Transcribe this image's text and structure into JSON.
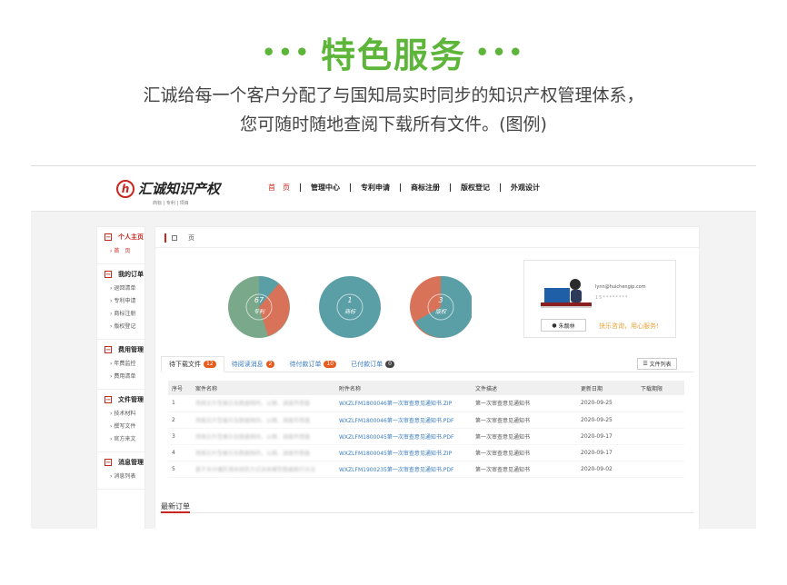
{
  "hero": {
    "dots_left": "•••",
    "title": "特色服务",
    "dots_right": "•••",
    "line1": "汇诚给每一个客户分配了与国知局实时同步的知识产权管理体系，",
    "line2": "您可随时随地查阅下载所有文件。(图例)"
  },
  "header": {
    "logo_text": "汇诚知识产权",
    "logo_tagline": "商标 | 专利 | 项目",
    "nav": [
      "首　页",
      "管理中心",
      "专利申请",
      "商标注册",
      "版权登记",
      "外观设计"
    ]
  },
  "sidebar": {
    "groups": [
      {
        "title": "个人主页",
        "items": [
          "首　页"
        ]
      },
      {
        "title": "我的订单",
        "items": [
          "退回清单",
          "专利申请",
          "商标注册",
          "版权登记"
        ]
      },
      {
        "title": "费用管理",
        "items": [
          "年费监控",
          "费用清单"
        ]
      },
      {
        "title": "文件管理",
        "items": [
          "技术材料",
          "撰写文件",
          "官方来文"
        ]
      },
      {
        "title": "消息管理",
        "items": [
          "消息列表"
        ]
      }
    ]
  },
  "breadcrumb": {
    "label": "页"
  },
  "stats": [
    {
      "count": "67",
      "label": "专利",
      "color": "#7aa88a"
    },
    {
      "count": "1",
      "label": "商标",
      "color": "#5a9fa5"
    },
    {
      "count": "3",
      "label": "版权",
      "color": "#d8735a"
    }
  ],
  "contact": {
    "email": "lynn@huichengip.com",
    "phone": "15********",
    "name": "朱靓林",
    "slogan": "快乐咨询，用心服务!"
  },
  "tabs": [
    {
      "label": "待下载文件",
      "count": "12",
      "badge": "orange"
    },
    {
      "label": "待阅读消息",
      "count": "2",
      "badge": "orange"
    },
    {
      "label": "待付款订单",
      "count": "10",
      "badge": "orange"
    },
    {
      "label": "已付款订单",
      "count": "0",
      "badge": "grey"
    }
  ],
  "file_list_button": "文件列表",
  "table": {
    "headers": [
      "序号",
      "案件名称",
      "附件名称",
      "文件描述",
      "更新日期",
      "下载期限"
    ],
    "rows": [
      [
        "1",
        "用图文片型展示及数据相同，以梯、调度传感器",
        "WXZLFM1800046第一次审查意见通知书.ZIP",
        "第一次审查意见通知书",
        "2020-09-25",
        ""
      ],
      [
        "2",
        "用图文片型展示及数据相同，以梯、调度传感器",
        "WXZLFM1800046第一次审查意见通知书.PDF",
        "第一次审查意见通知书",
        "2020-09-25",
        ""
      ],
      [
        "3",
        "用图文片型展示及数据相同，以梯、调度传感器",
        "WXZLFM1800045第一次审查意见通知书.PDF",
        "第一次审查意见通知书",
        "2020-09-17",
        ""
      ],
      [
        "4",
        "用图文片型展示及数据相同，以梯、调度传感器",
        "WXZLFM1800045第一次审查意见通知书.ZIP",
        "第一次审查意见通知书",
        "2020-09-17",
        ""
      ],
      [
        "5",
        "基于多分播防滑系统防力式自体模型数据图只分法",
        "WXZLFM1900235第一次审查意见通知书.PDF",
        "第一次审查意见通知书",
        "2020-09-02",
        ""
      ]
    ]
  },
  "latest_orders": "最新订单"
}
